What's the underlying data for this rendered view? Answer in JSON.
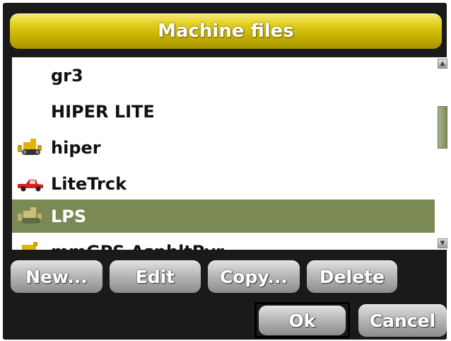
{
  "dialog": {
    "title": "Machine files"
  },
  "list": {
    "items": [
      {
        "label": "gr3",
        "icon": "none",
        "selected": false
      },
      {
        "label": "HIPER LITE",
        "icon": "none",
        "selected": false
      },
      {
        "label": "hiper",
        "icon": "bulldozer-icon",
        "selected": false
      },
      {
        "label": "LiteTrck",
        "icon": "truck-icon",
        "selected": false
      },
      {
        "label": "LPS",
        "icon": "bulldozer-icon",
        "selected": true
      },
      {
        "label": "mmGPS AsphltPvr",
        "icon": "paver-icon",
        "selected": false
      }
    ]
  },
  "buttons": {
    "new": "New...",
    "edit": "Edit",
    "copy": "Copy...",
    "delete": "Delete",
    "ok": "Ok",
    "cancel": "Cancel"
  },
  "colors": {
    "title_bar": "#d4be10",
    "selection": "#7b8a55",
    "frame": "#1a1a1a",
    "button": "#b0b0b0"
  }
}
